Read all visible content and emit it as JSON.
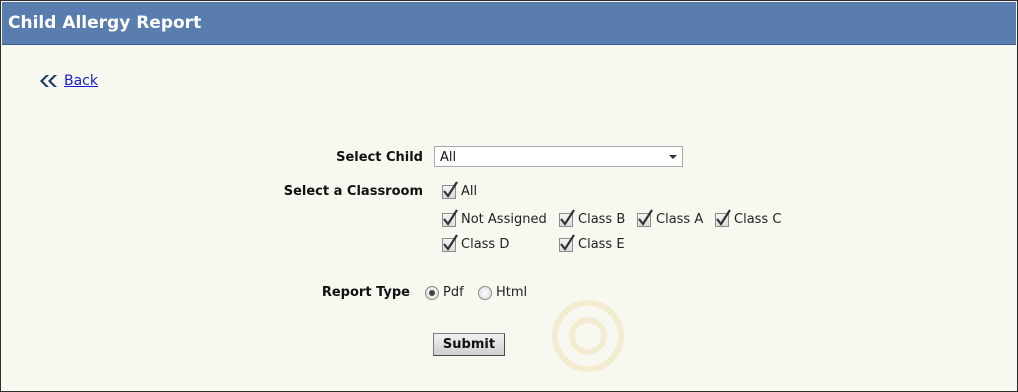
{
  "header": {
    "title": "Child Allergy Report"
  },
  "nav": {
    "back_label": "Back"
  },
  "form": {
    "select_child": {
      "label": "Select Child",
      "value": "All"
    },
    "classroom": {
      "label": "Select a Classroom",
      "options": [
        {
          "label": "All",
          "checked": true
        },
        {
          "label": "Not Assigned",
          "checked": true
        },
        {
          "label": "Class B",
          "checked": true
        },
        {
          "label": "Class A",
          "checked": true
        },
        {
          "label": "Class C",
          "checked": true
        },
        {
          "label": "Class D",
          "checked": true
        },
        {
          "label": "Class E",
          "checked": true
        }
      ]
    },
    "report_type": {
      "label": "Report Type",
      "options": [
        {
          "label": "Pdf",
          "selected": true
        },
        {
          "label": "Html",
          "selected": false
        }
      ]
    },
    "submit_label": "Submit"
  },
  "colors": {
    "header_bg": "#5a7db0",
    "page_bg": "#f7f8f0",
    "link": "#1a1ad0"
  }
}
